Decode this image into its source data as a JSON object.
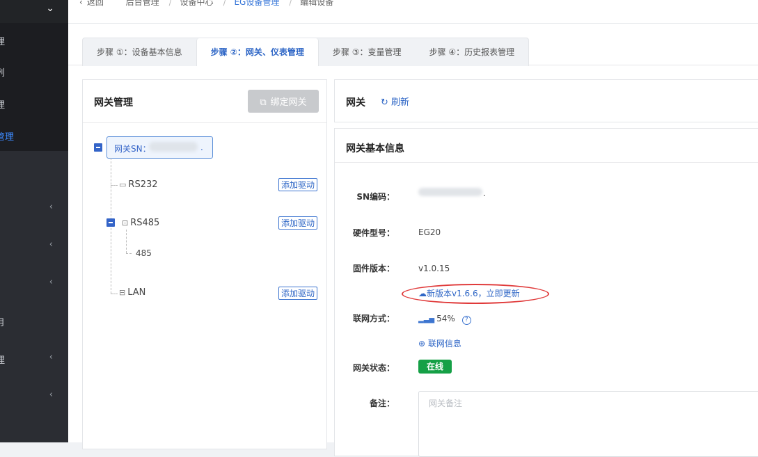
{
  "sidebar": {
    "items": [
      {
        "label": "理",
        "arrow": ""
      },
      {
        "label": "列",
        "arrow": ""
      },
      {
        "label": "理",
        "arrow": ""
      },
      {
        "label": "管理",
        "arrow": ""
      },
      {
        "label": "",
        "arrow": "‹"
      },
      {
        "label": "",
        "arrow": "‹"
      },
      {
        "label": "",
        "arrow": "‹"
      },
      {
        "label": "月",
        "arrow": ""
      },
      {
        "label": "理",
        "arrow": "‹"
      },
      {
        "label": "",
        "arrow": "‹"
      }
    ]
  },
  "breadcrumb": {
    "back": "返回",
    "items": [
      "后台管理",
      "设备中心",
      "EG设备管理",
      "编辑设备"
    ]
  },
  "tabs": [
    {
      "label": "步骤 ①：设备基本信息",
      "active": false
    },
    {
      "label": "步骤 ②：网关、仪表管理",
      "active": true
    },
    {
      "label": "步骤 ③：变量管理",
      "active": false
    },
    {
      "label": "步骤 ④：历史报表管理",
      "active": false
    }
  ],
  "gateway_panel": {
    "title": "网关管理",
    "bind_button": "绑定网关",
    "gateway_node": "网关SN：",
    "gateway_node_suffix": ".",
    "children": {
      "rs232": "RS232",
      "rs485": "RS485",
      "rs485_child": "485",
      "lan": "LAN"
    },
    "add_driver": "添加驱动"
  },
  "gateway_header": {
    "title": "网关",
    "refresh": "刷新"
  },
  "gateway_info": {
    "title": "网关基本信息",
    "sn_label": "SN编码：",
    "sn_suffix": ".",
    "model_label": "硬件型号：",
    "model_value": "EG20",
    "firmware_label": "固件版本：",
    "firmware_value": "v1.0.15",
    "update_text": "新版本v1.6.6，立即更新",
    "network_label": "联网方式：",
    "signal": "54%",
    "network_info": "联网信息",
    "status_label": "网关状态：",
    "status_value": "在线",
    "remark_label": "备注：",
    "remark_placeholder": "网关备注"
  },
  "colors": {
    "accent": "#2e66c6",
    "online": "#15a046",
    "annotation": "#e03a3a",
    "sidebar_bg": "#2b2d33"
  }
}
